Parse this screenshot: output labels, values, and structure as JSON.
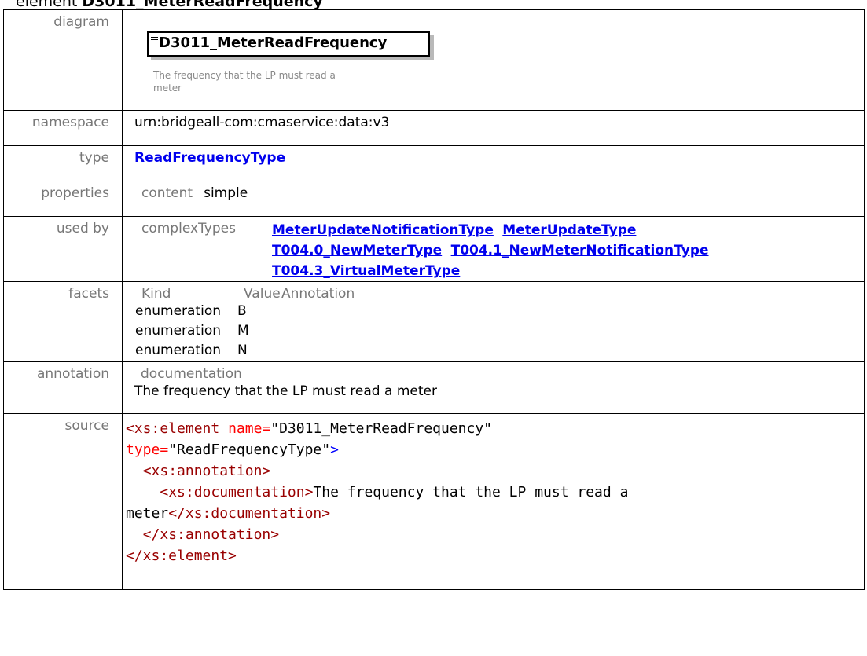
{
  "heading": {
    "prefix": "element ",
    "name": "D3011_MeterReadFrequency"
  },
  "diagram": {
    "label": "diagram",
    "box_title": "D3011_MeterReadFrequency",
    "note": "The frequency that the LP must read a meter"
  },
  "namespace": {
    "label": "namespace",
    "value": "urn:bridgeall-com:cmaservice:data:v3"
  },
  "type": {
    "label": "type",
    "value": "ReadFrequencyType"
  },
  "properties": {
    "label": "properties",
    "key": "content",
    "value": "simple"
  },
  "used_by": {
    "label": "used by",
    "key": "complexTypes",
    "links": [
      "MeterUpdateNotificationType",
      "MeterUpdateType",
      "T004.0_NewMeterType",
      "T004.1_NewMeterNotificationType",
      "T004.3_VirtualMeterType"
    ]
  },
  "facets": {
    "label": "facets",
    "columns": [
      "Kind",
      "Value",
      "Annotation"
    ],
    "rows": [
      {
        "kind": "enumeration",
        "value": "B"
      },
      {
        "kind": "enumeration",
        "value": "M"
      },
      {
        "kind": "enumeration",
        "value": "N"
      }
    ]
  },
  "annotation": {
    "label": "annotation",
    "key": "documentation",
    "text": "The frequency that the LP must read a meter"
  },
  "source": {
    "label": "source",
    "element_open": "<xs:element",
    "name_attr": "name=",
    "name_value": "\"D3011_MeterReadFrequency\"",
    "type_attr": "type=",
    "type_value": "\"ReadFrequencyType\"",
    "gt": ">",
    "annotation_open": "<xs:annotation>",
    "documentation_open": "<xs:documentation>",
    "doc_text_1": "The frequency that the LP must read a",
    "doc_text_2": "meter",
    "documentation_close": "</xs:documentation>",
    "annotation_close": "</xs:annotation>",
    "element_close": "</xs:element>"
  }
}
